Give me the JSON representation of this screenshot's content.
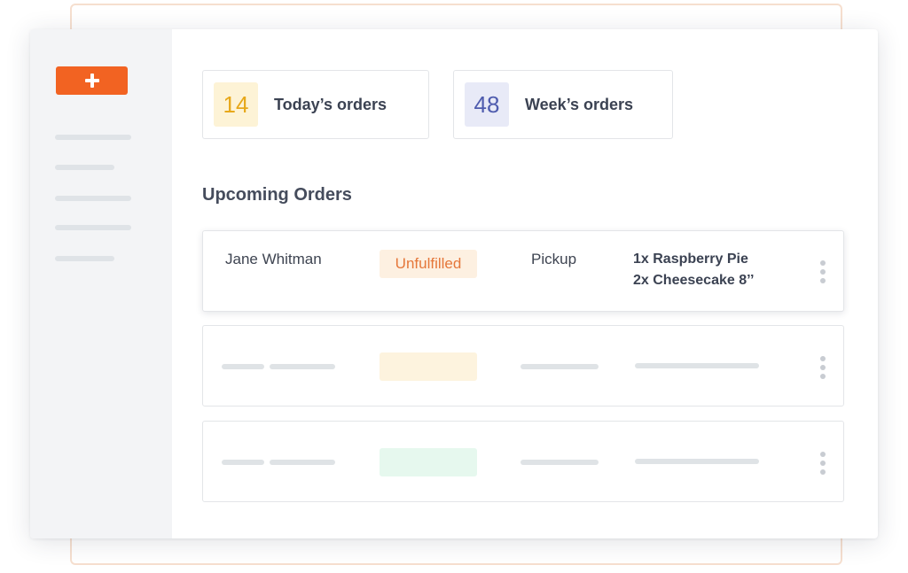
{
  "colors": {
    "accent": "#f26322",
    "today_badge_bg": "#fdf3d6",
    "today_badge_text": "#e7a81a",
    "week_badge_bg": "#e8eaf7",
    "week_badge_text": "#4f5cae",
    "status_unfulfilled_bg": "#fdf0e1",
    "status_unfulfilled_text": "#e5773a",
    "placeholder_status_1": "#fdf3de",
    "placeholder_status_2": "#e6f8ee"
  },
  "sidebar": {
    "add_button_icon": "plus-icon",
    "nav_item_count": 5
  },
  "stats": {
    "today": {
      "count": "14",
      "label": "Today’s orders"
    },
    "week": {
      "count": "48",
      "label": "Week’s orders"
    }
  },
  "orders": {
    "title": "Upcoming Orders",
    "rows": [
      {
        "customer": "Jane Whitman",
        "status": "Unfulfilled",
        "method": "Pickup",
        "items": [
          "1x Raspberry Pie",
          "2x Cheesecake 8’’"
        ],
        "menu_icon": "kebab-menu-icon"
      }
    ]
  }
}
